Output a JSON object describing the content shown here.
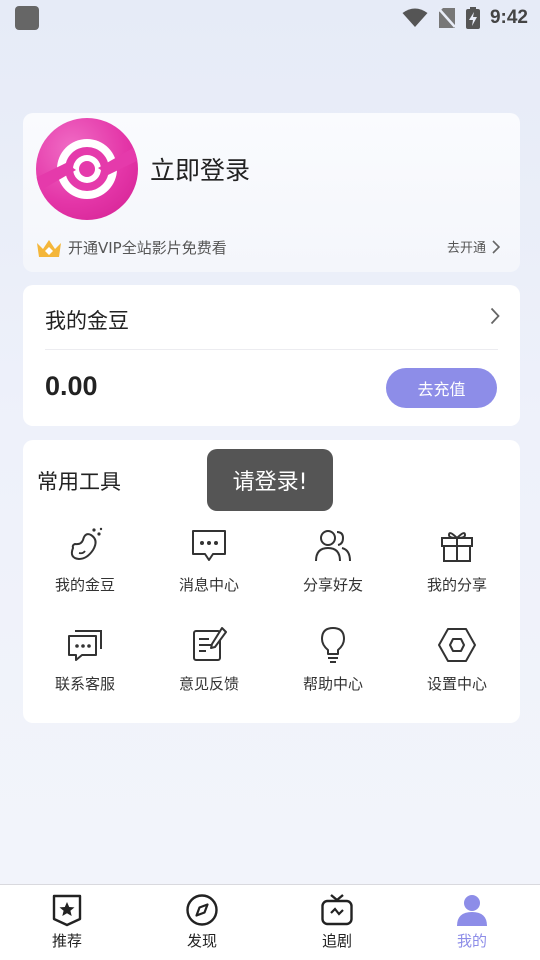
{
  "status_bar": {
    "time": "9:42"
  },
  "profile": {
    "login_label": "立即登录",
    "vip_promo": "开通VIP全站影片免费看",
    "vip_open": "去开通"
  },
  "beans": {
    "title": "我的金豆",
    "value": "0.00",
    "recharge_label": "去充值"
  },
  "tools": {
    "title": "常用工具",
    "items": [
      {
        "label": "我的金豆",
        "icon": "bean-icon"
      },
      {
        "label": "消息中心",
        "icon": "message-icon"
      },
      {
        "label": "分享好友",
        "icon": "friends-icon"
      },
      {
        "label": "我的分享",
        "icon": "gift-icon"
      },
      {
        "label": "联系客服",
        "icon": "chat-icon"
      },
      {
        "label": "意见反馈",
        "icon": "feedback-icon"
      },
      {
        "label": "帮助中心",
        "icon": "lightbulb-icon"
      },
      {
        "label": "设置中心",
        "icon": "settings-icon"
      }
    ]
  },
  "toast": {
    "message": "请登录!"
  },
  "bottom_nav": {
    "items": [
      {
        "label": "推荐",
        "icon": "badge-star-icon"
      },
      {
        "label": "发现",
        "icon": "compass-icon"
      },
      {
        "label": "追剧",
        "icon": "tv-icon"
      },
      {
        "label": "我的",
        "icon": "user-icon"
      }
    ],
    "active": "我的",
    "active_color": "#8d8de8"
  },
  "colors": {
    "accent": "#8d8de8",
    "avatar": "#e436a8",
    "crown": "#f4b63a"
  }
}
